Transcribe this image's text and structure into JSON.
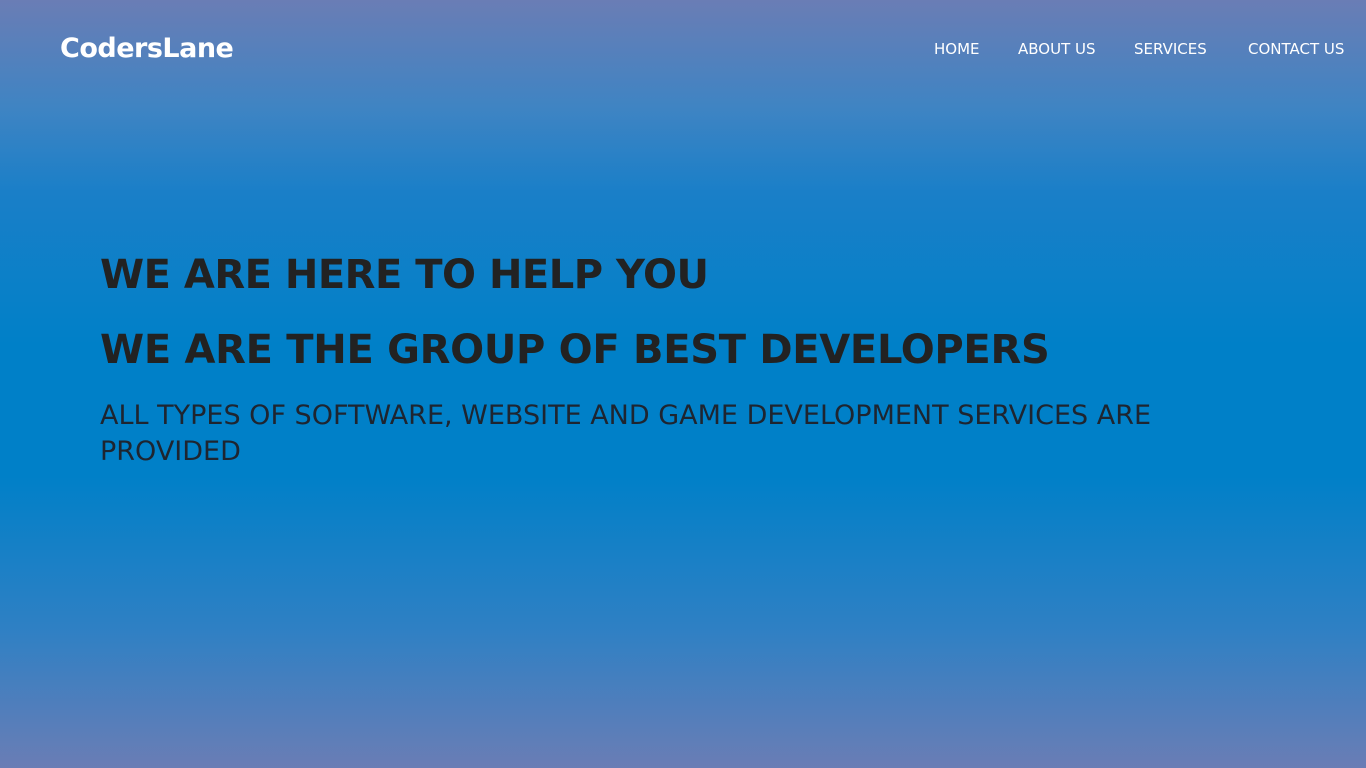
{
  "brand": {
    "logo_text": "CodersLane"
  },
  "nav": {
    "items": [
      {
        "label": "HOME"
      },
      {
        "label": "ABOUT US"
      },
      {
        "label": "SERVICES"
      },
      {
        "label": "CONTACT US"
      }
    ]
  },
  "hero": {
    "headline_1": "WE ARE HERE TO HELP YOU",
    "headline_2": "WE ARE THE GROUP OF BEST DEVELOPERS",
    "subtext": "ALL TYPES OF SOFTWARE, WEBSITE AND GAME DEVELOPMENT SERVICES ARE PROVIDED"
  },
  "colors": {
    "background_main": "#0080c8",
    "background_edge": "#6a7db5",
    "nav_text": "#ffffff",
    "hero_text": "#222222"
  }
}
